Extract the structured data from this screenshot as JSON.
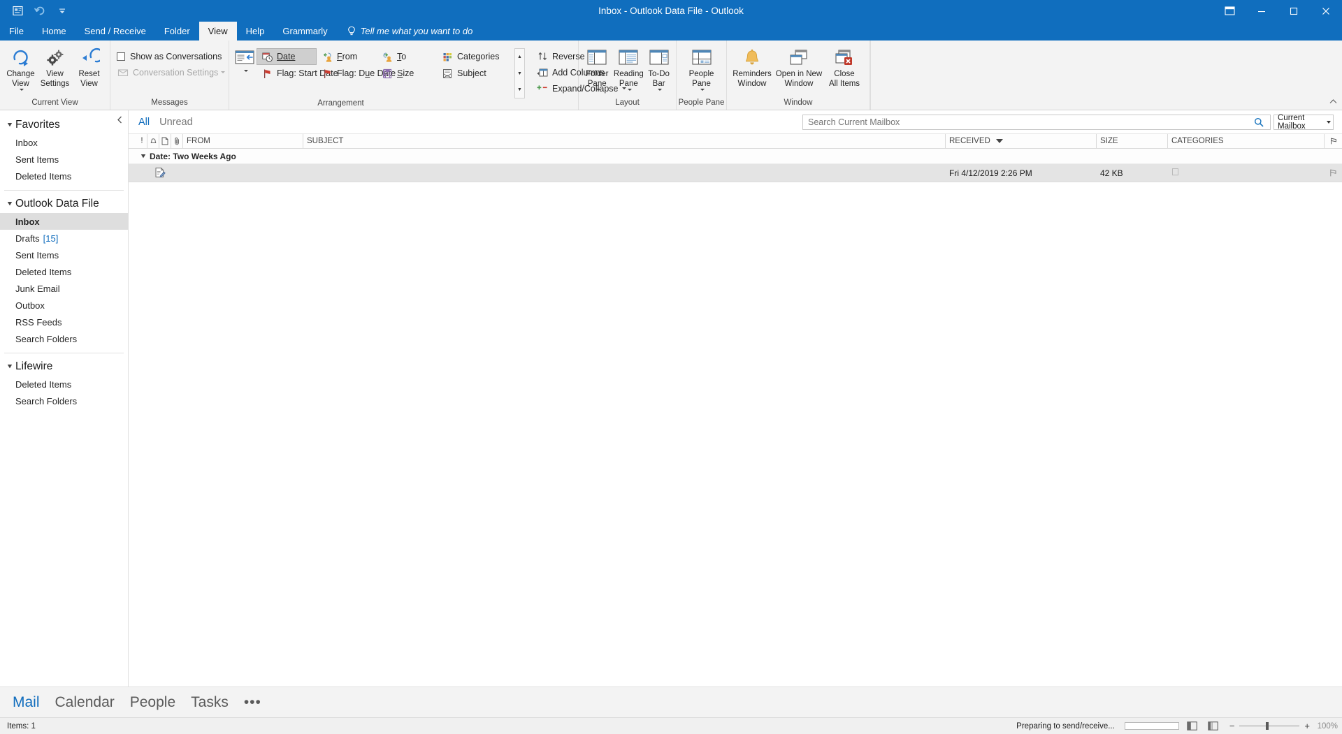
{
  "window": {
    "title": "Inbox - Outlook Data File - Outlook",
    "qat": [
      {
        "name": "save-quick-access",
        "label": "Save"
      },
      {
        "name": "undo",
        "label": "Undo"
      },
      {
        "name": "customize-quick-access-toolbar",
        "label": "Customize Quick Access Toolbar"
      }
    ],
    "controls": {
      "ribbon_display": "Ribbon Display Options",
      "minimize": "Minimize",
      "restore": "Restore Down",
      "close": "Close"
    }
  },
  "tabs": [
    {
      "label": "File",
      "active": false
    },
    {
      "label": "Home",
      "active": false
    },
    {
      "label": "Send / Receive",
      "active": false
    },
    {
      "label": "Folder",
      "active": false
    },
    {
      "label": "View",
      "active": true
    },
    {
      "label": "Help",
      "active": false
    },
    {
      "label": "Grammarly",
      "active": false
    }
  ],
  "tell_me": "Tell me what you want to do",
  "ribbon": {
    "groups": [
      {
        "name": "current-view",
        "label": "Current View"
      },
      {
        "name": "messages",
        "label": "Messages"
      },
      {
        "name": "arrangement",
        "label": "Arrangement"
      },
      {
        "name": "layout",
        "label": "Layout"
      },
      {
        "name": "people-pane",
        "label": "People Pane"
      },
      {
        "name": "window",
        "label": "Window"
      }
    ],
    "current_view": {
      "change_view": "Change\nView",
      "view_settings": "View\nSettings",
      "reset_view": "Reset\nView"
    },
    "messages": {
      "show_as_conversations": "Show as Conversations",
      "conversation_settings": "Conversation Settings",
      "message_preview": "Message\nPreview"
    },
    "arrangement": {
      "items": [
        {
          "label": "Date",
          "selected": true
        },
        {
          "label": "From",
          "selected": false
        },
        {
          "label": "To",
          "selected": false
        },
        {
          "label": "Categories",
          "selected": false
        },
        {
          "label": "Flag: Start Date",
          "selected": false
        },
        {
          "label": "Flag: Due Date",
          "selected": false
        },
        {
          "label": "Size",
          "selected": false
        },
        {
          "label": "Subject",
          "selected": false
        }
      ],
      "reverse_sort": "Reverse Sort",
      "add_columns": "Add Columns",
      "expand_collapse": "Expand/Collapse"
    },
    "layout": {
      "folder_pane": "Folder\nPane",
      "reading_pane": "Reading\nPane",
      "todo_bar": "To-Do\nBar"
    },
    "people_pane": {
      "people_pane": "People\nPane"
    },
    "window": {
      "reminders_window": "Reminders\nWindow",
      "open_in_new_window": "Open in New\nWindow",
      "close_all_items": "Close\nAll Items"
    }
  },
  "sidebar": {
    "sections": [
      {
        "name": "favorites",
        "header": "Favorites",
        "items": [
          {
            "label": "Inbox",
            "selected": false
          },
          {
            "label": "Sent Items",
            "selected": false
          },
          {
            "label": "Deleted Items",
            "selected": false
          }
        ]
      },
      {
        "name": "outlook-data-file",
        "header": "Outlook Data File",
        "items": [
          {
            "label": "Inbox",
            "selected": true
          },
          {
            "label": "Drafts",
            "count": "[15]",
            "selected": false
          },
          {
            "label": "Sent Items",
            "selected": false
          },
          {
            "label": "Deleted Items",
            "selected": false
          },
          {
            "label": "Junk Email",
            "selected": false
          },
          {
            "label": "Outbox",
            "selected": false
          },
          {
            "label": "RSS Feeds",
            "selected": false
          },
          {
            "label": "Search Folders",
            "selected": false
          }
        ]
      },
      {
        "name": "lifewire",
        "header": "Lifewire",
        "items": [
          {
            "label": "Deleted Items",
            "selected": false
          },
          {
            "label": "Search Folders",
            "selected": false
          }
        ]
      }
    ]
  },
  "message_pane": {
    "filters": [
      {
        "label": "All",
        "active": true
      },
      {
        "label": "Unread",
        "active": false
      }
    ],
    "search": {
      "value": "",
      "placeholder": "Search Current Mailbox"
    },
    "scope": "Current Mailbox",
    "columns": [
      {
        "label": "!",
        "type": "icon"
      },
      {
        "label": "reminder",
        "type": "icon"
      },
      {
        "label": "page",
        "type": "icon"
      },
      {
        "label": "attachment",
        "type": "icon"
      },
      {
        "label": "FROM",
        "type": "text"
      },
      {
        "label": "SUBJECT",
        "type": "text"
      },
      {
        "label": "RECEIVED",
        "type": "text",
        "sorted": true
      },
      {
        "label": "SIZE",
        "type": "text"
      },
      {
        "label": "CATEGORIES",
        "type": "text"
      },
      {
        "label": "flag",
        "type": "icon"
      }
    ],
    "groups": [
      {
        "header": "Date: Two Weeks Ago",
        "rows": [
          {
            "from": "",
            "subject": "",
            "received": "Fri 4/12/2019 2:26 PM",
            "size": "42 KB",
            "categories": "",
            "selected": true
          }
        ]
      }
    ]
  },
  "bottom_nav": [
    {
      "label": "Mail",
      "active": true
    },
    {
      "label": "Calendar",
      "active": false
    },
    {
      "label": "People",
      "active": false
    },
    {
      "label": "Tasks",
      "active": false
    },
    {
      "label": "•••",
      "active": false
    }
  ],
  "status_bar": {
    "items_count": "Items: 1",
    "send_receive_status": "Preparing to send/receive...",
    "zoom_level": "100%"
  },
  "colors": {
    "accent": "#106ebe",
    "link": "#0f6cbd",
    "ribbon_bg": "#f3f3f3",
    "selection": "#e4e4e4"
  }
}
